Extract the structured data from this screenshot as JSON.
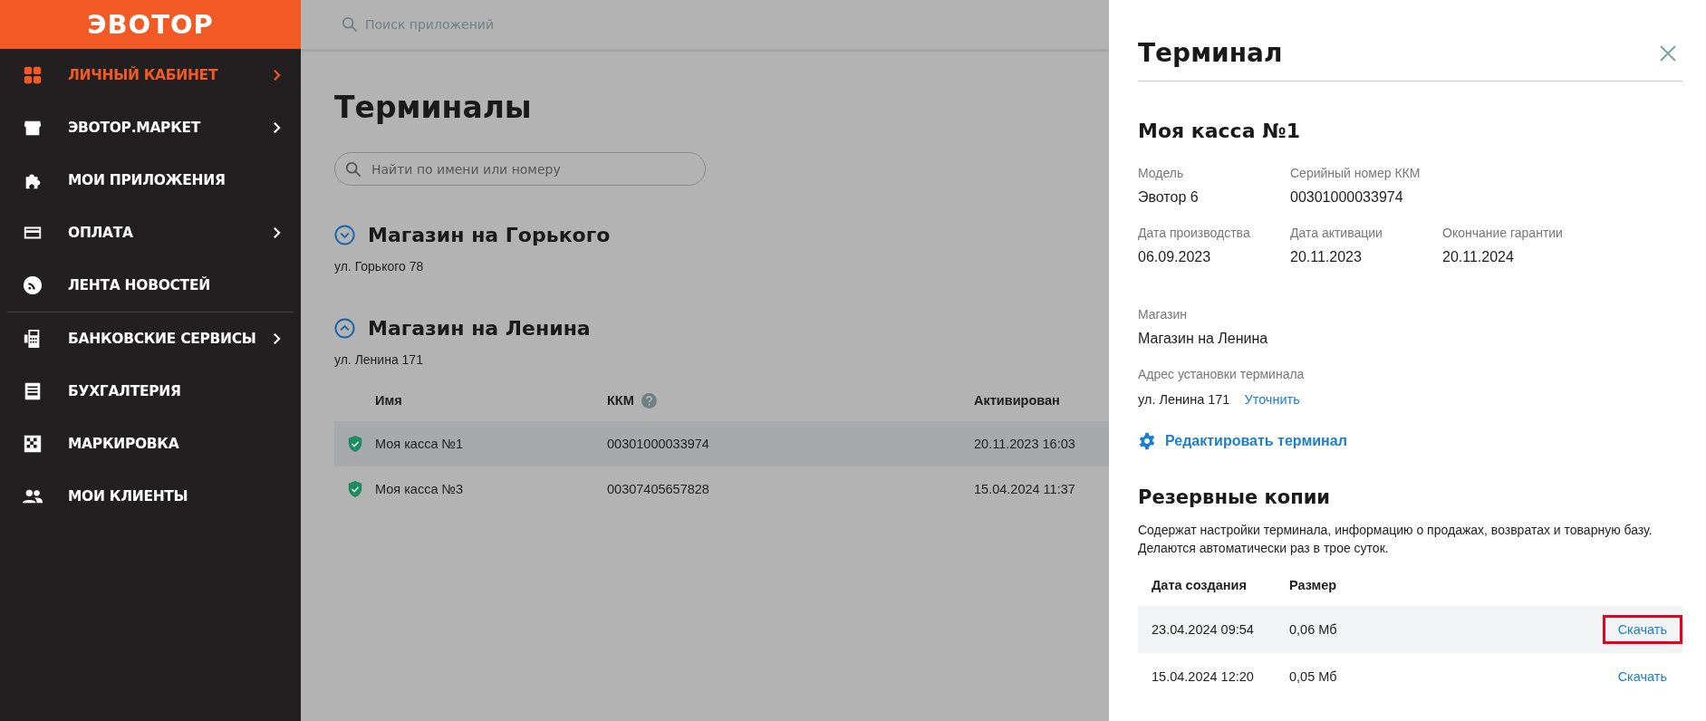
{
  "sidebar": {
    "logo": "ЭВОТОР",
    "groups": [
      [
        {
          "label": "ЛИЧНЫЙ КАБИНЕТ",
          "selected": true,
          "has_submenu": true
        },
        {
          "label": "ЭВОТОР.МАРКЕТ",
          "selected": false,
          "has_submenu": true
        },
        {
          "label": "МОИ ПРИЛОЖЕНИЯ",
          "selected": false,
          "has_submenu": false
        },
        {
          "label": "ОПЛАТА",
          "selected": false,
          "has_submenu": true
        },
        {
          "label": "ЛЕНТА НОВОСТЕЙ",
          "selected": false,
          "has_submenu": false
        }
      ],
      [
        {
          "label": "БАНКОВСКИЕ СЕРВИСЫ",
          "selected": false,
          "has_submenu": true
        },
        {
          "label": "БУХГАЛТЕРИЯ",
          "selected": false,
          "has_submenu": false
        },
        {
          "label": "МАРКИРОВКА",
          "selected": false,
          "has_submenu": false
        },
        {
          "label": "МОИ КЛИЕНТЫ",
          "selected": false,
          "has_submenu": false
        }
      ]
    ]
  },
  "top_search": {
    "placeholder": "Поиск приложений"
  },
  "page": {
    "title": "Терминалы",
    "search": {
      "placeholder": "Найти по имени или номеру"
    },
    "stores": [
      {
        "name": "Магазин на Горького",
        "address": "ул. Горького 78",
        "expanded": false
      },
      {
        "name": "Магазин на Ленина",
        "address": "ул. Ленина 171",
        "expanded": true,
        "table": {
          "columns": [
            "Имя",
            "ККМ",
            "Активирован"
          ],
          "rows": [
            {
              "name": "Моя касса №1",
              "kkm": "00301000033974",
              "activated": "20.11.2023 16:03",
              "selected": true
            },
            {
              "name": "Моя касса №3",
              "kkm": "00307405657828",
              "activated": "15.04.2024 11:37",
              "selected": false
            }
          ]
        }
      }
    ]
  },
  "panel": {
    "title": "Терминал",
    "name": "Моя касса №1",
    "fields": [
      [
        {
          "label": "Модель",
          "value": "Эвотор 6"
        },
        {
          "label": "Серийный номер ККМ",
          "value": "00301000033974"
        }
      ],
      [
        {
          "label": "Дата производства",
          "value": "06.09.2023"
        },
        {
          "label": "Дата активации",
          "value": "20.11.2023"
        },
        {
          "label": "Окончание гарантии",
          "value": "20.11.2024"
        }
      ]
    ],
    "store_label": "Магазин",
    "store": "Магазин на Ленина",
    "address_label": "Адрес установки терминала",
    "address": "ул. Ленина 171",
    "address_link": "Уточнить",
    "edit_link": "Редактировать терминал",
    "backups": {
      "title": "Резервные копии",
      "description": "Содержат настройки терминала, информацию о продажах, возвратах и товарную базу. Делаются автоматически раз в трое суток.",
      "columns": [
        "Дата создания",
        "Размер"
      ],
      "rows": [
        {
          "date": "23.04.2024 09:54",
          "size": "0,06 Мб",
          "action": "Скачать",
          "selected": true,
          "highlighted": true
        },
        {
          "date": "15.04.2024 12:20",
          "size": "0,05 Мб",
          "action": "Скачать",
          "selected": false,
          "highlighted": false
        }
      ]
    }
  }
}
